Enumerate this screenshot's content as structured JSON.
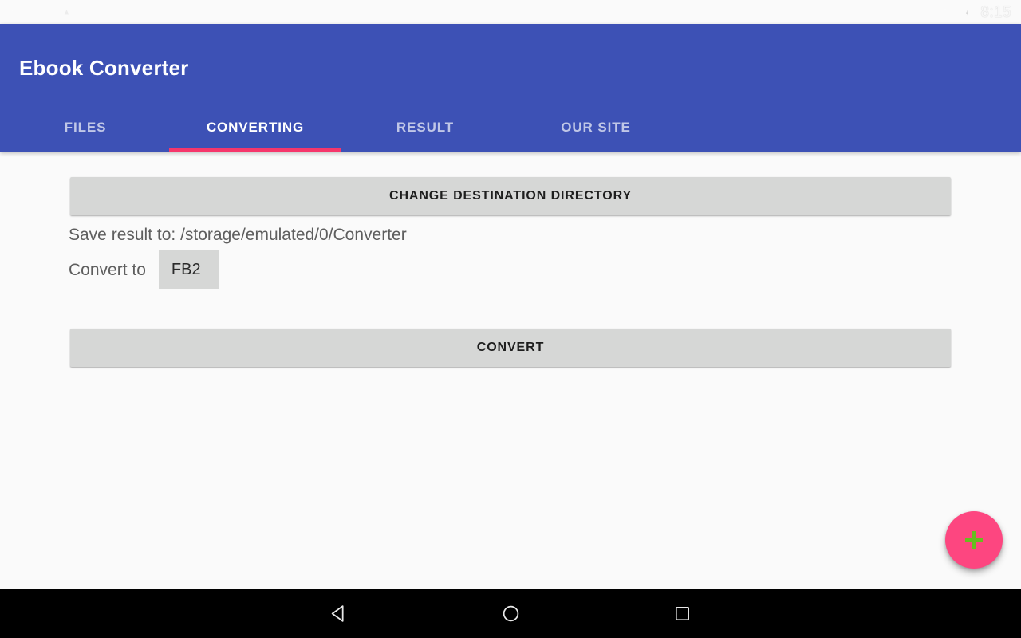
{
  "status_bar": {
    "icons": [
      "download-icon",
      "nfc-n-icon",
      "app-badge-icon"
    ],
    "signal": "LTE",
    "battery": "battery-icon",
    "clock": "8:15"
  },
  "app_bar": {
    "title": "Ebook Converter",
    "background_color": "#3D51B5",
    "tabs": [
      {
        "label": "FILES",
        "active": false
      },
      {
        "label": "CONVERTING",
        "active": true
      },
      {
        "label": "RESULT",
        "active": false
      },
      {
        "label": "OUR SITE",
        "active": false
      }
    ],
    "indicator_color": "#F6366B"
  },
  "content": {
    "change_destination_button": "CHANGE DESTINATION DIRECTORY",
    "save_path_text": "Save result to: /storage/emulated/0/Converter",
    "convert_to_label": "Convert to",
    "selected_format": "FB2",
    "convert_button": "CONVERT",
    "background_color": "#FAFAFA",
    "button_color": "#D6D7D6"
  },
  "fab": {
    "icon": "plus-icon",
    "background_color": "#FD4680",
    "icon_color": "#67BD1F"
  },
  "navigation_bar": {
    "back": "back-triangle-icon",
    "home": "home-circle-icon",
    "recents": "recents-square-icon",
    "background_color": "#000000"
  }
}
